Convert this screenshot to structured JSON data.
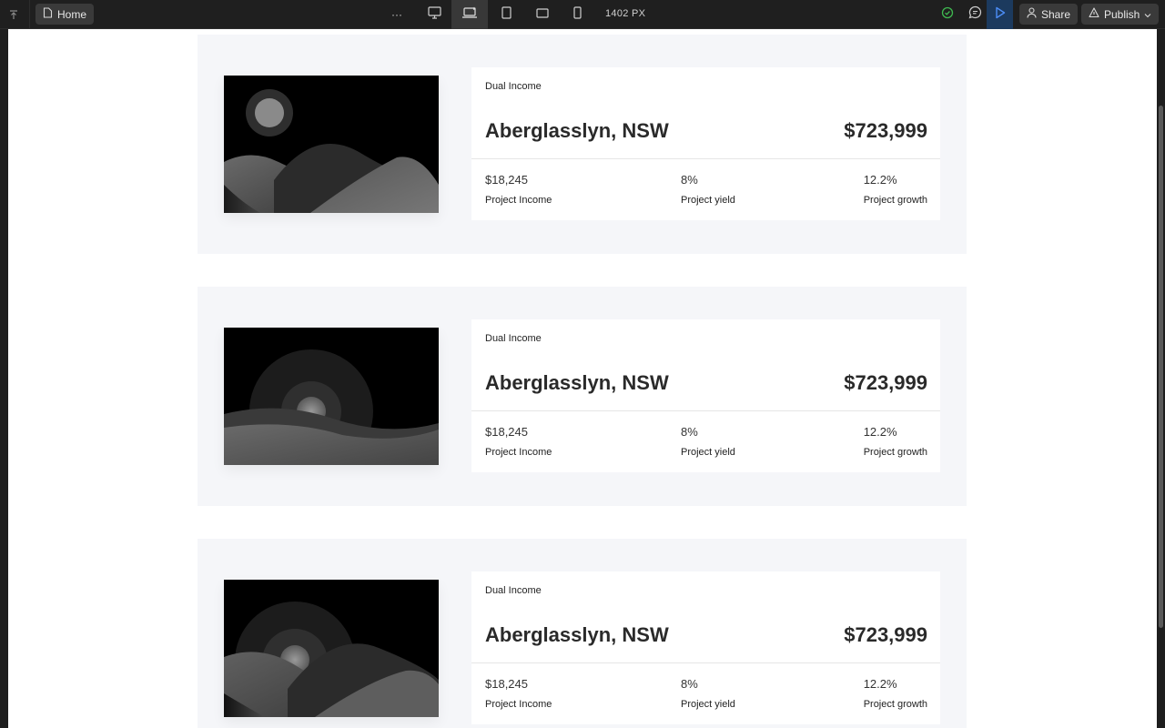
{
  "toolbar": {
    "page_name": "Home",
    "more_label": "···",
    "viewport_width": "1402 PX",
    "share_label": "Share",
    "publish_label": "Publish"
  },
  "listings": [
    {
      "type": "Dual Income",
      "location": "Aberglasslyn, NSW",
      "price": "$723,999",
      "stats": [
        {
          "value": "$18,245",
          "label": "Project Income"
        },
        {
          "value": "8%",
          "label": "Project yield"
        },
        {
          "value": "12.2%",
          "label": "Project growth"
        }
      ]
    },
    {
      "type": "Dual Income",
      "location": "Aberglasslyn, NSW",
      "price": "$723,999",
      "stats": [
        {
          "value": "$18,245",
          "label": "Project Income"
        },
        {
          "value": "8%",
          "label": "Project yield"
        },
        {
          "value": "12.2%",
          "label": "Project growth"
        }
      ]
    },
    {
      "type": "Dual Income",
      "location": "Aberglasslyn, NSW",
      "price": "$723,999",
      "stats": [
        {
          "value": "$18,245",
          "label": "Project Income"
        },
        {
          "value": "8%",
          "label": "Project yield"
        },
        {
          "value": "12.2%",
          "label": "Project growth"
        }
      ]
    }
  ],
  "icons": {
    "collapse": "collapse-up-icon",
    "page": "page-icon",
    "desktop": "desktop-icon",
    "laptop": "laptop-icon",
    "tablet": "tablet-icon",
    "tablet_landscape": "tablet-landscape-icon",
    "mobile": "mobile-icon",
    "status": "check-circle-icon",
    "comments": "comment-icon",
    "preview": "play-icon",
    "user": "user-icon",
    "publish": "publish-icon",
    "chevron": "chevron-down-icon",
    "placeholder": "image-placeholder-icon"
  },
  "colors": {
    "toolbar_bg": "#1f1f1f",
    "card_bg": "#f5f6f9",
    "status_green": "#3fb950",
    "preview_blue": "#4c8df6"
  }
}
